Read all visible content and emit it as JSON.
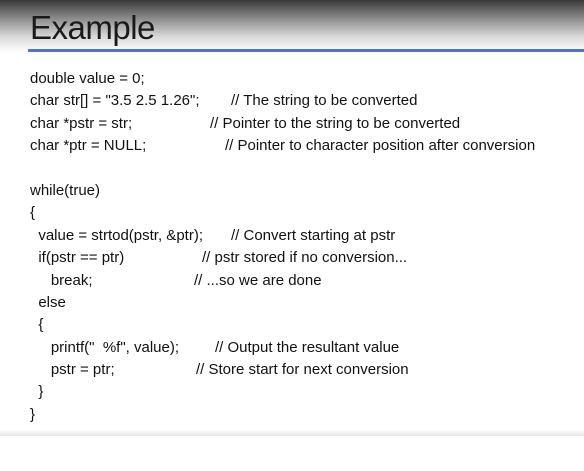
{
  "slide": {
    "title": "Example",
    "lines": [
      {
        "code": "double value = 0;",
        "comment": ""
      },
      {
        "code": "char str[] = \"3.5 2.5 1.26\";",
        "comment": "// The string to be converted"
      },
      {
        "code": "char *pstr = str;",
        "comment": "// Pointer to the string to be converted"
      },
      {
        "code": "char *ptr = NULL;",
        "comment": "// Pointer to character position after conversion"
      },
      {
        "code": "",
        "comment": ""
      },
      {
        "code": "while(true)",
        "comment": ""
      },
      {
        "code": "{",
        "comment": ""
      },
      {
        "code": "  value = strtod(pstr, &ptr);",
        "comment": "// Convert starting at pstr"
      },
      {
        "code": "  if(pstr == ptr)",
        "comment": "// pstr stored if no conversion..."
      },
      {
        "code": "     break;",
        "comment": "// ...so we are done"
      },
      {
        "code": "  else",
        "comment": ""
      },
      {
        "code": "  {",
        "comment": ""
      },
      {
        "code": "     printf(\"  %f\", value);",
        "comment": "// Output the resultant value"
      },
      {
        "code": "     pstr = ptr;",
        "comment": "// Store start for next conversion"
      },
      {
        "code": "  }",
        "comment": ""
      },
      {
        "code": "}",
        "comment": ""
      }
    ]
  }
}
